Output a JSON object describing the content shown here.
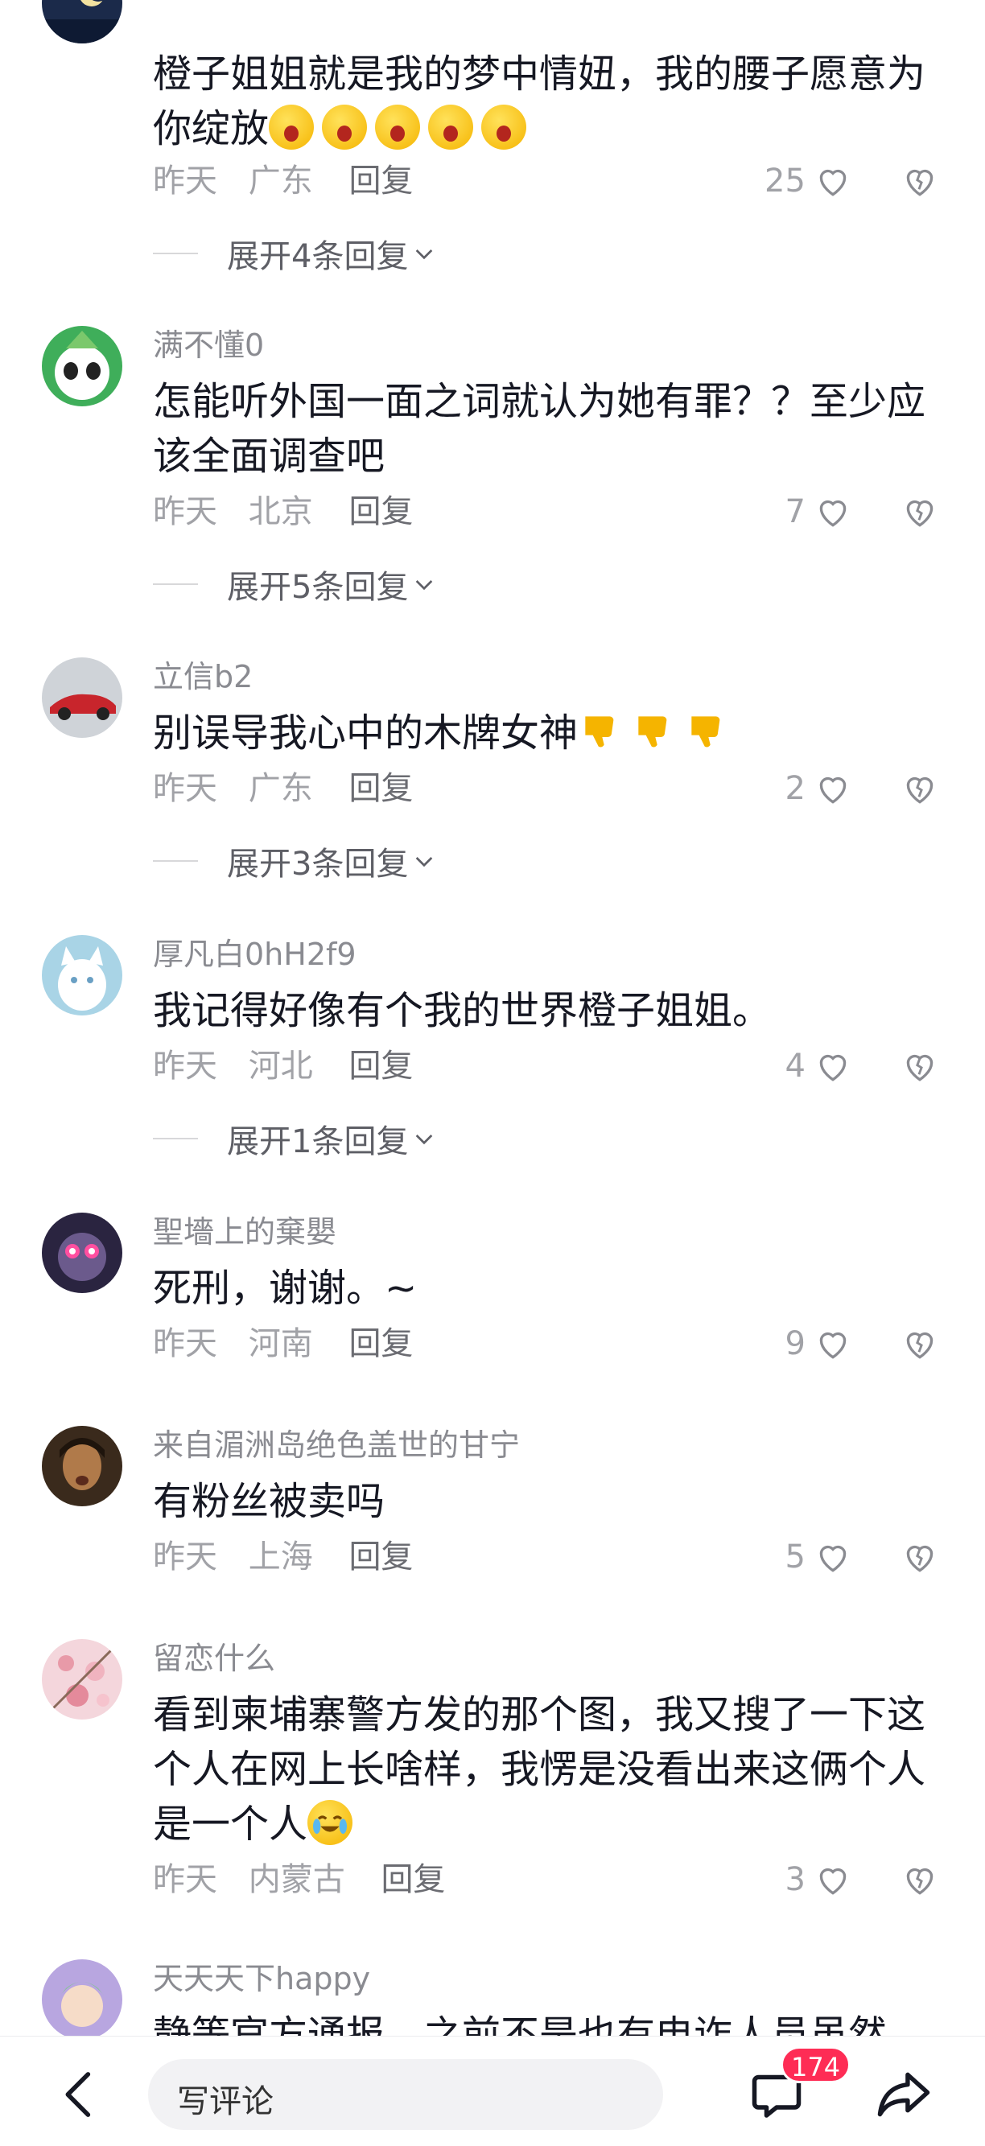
{
  "comments": [
    {
      "username": "",
      "text": "橙子姐姐就是我的梦中情妞，我的腰子愿意为你绽放",
      "emojis": [
        "shock-emoji",
        "shock-emoji",
        "shock-emoji",
        "shock-emoji",
        "shock-emoji"
      ],
      "time": "昨天",
      "location": "广东",
      "reply": "回复",
      "likes": "25",
      "expand": "展开4条回复"
    },
    {
      "username": "满不懂0",
      "text": "怎能听外国一面之词就认为她有罪？？至少应该全面调查吧",
      "emojis": [],
      "time": "昨天",
      "location": "北京",
      "reply": "回复",
      "likes": "7",
      "expand": "展开5条回复"
    },
    {
      "username": "立信b2",
      "text": "别误导我心中的木牌女神",
      "emojis": [
        "thumbs-down-emoji",
        "thumbs-down-emoji",
        "thumbs-down-emoji"
      ],
      "time": "昨天",
      "location": "广东",
      "reply": "回复",
      "likes": "2",
      "expand": "展开3条回复"
    },
    {
      "username": "厚凡白0hH2f9",
      "text": "我记得好像有个我的世界橙子姐姐。",
      "emojis": [],
      "time": "昨天",
      "location": "河北",
      "reply": "回复",
      "likes": "4",
      "expand": "展开1条回复"
    },
    {
      "username": "聖墻上的棄嬰",
      "text": "死刑，谢谢。~",
      "emojis": [],
      "time": "昨天",
      "location": "河南",
      "reply": "回复",
      "likes": "9",
      "expand": ""
    },
    {
      "username": "来自湄洲岛绝色盖世的甘宁",
      "text": "有粉丝被卖吗",
      "emojis": [],
      "time": "昨天",
      "location": "上海",
      "reply": "回复",
      "likes": "5",
      "expand": ""
    },
    {
      "username": "留恋什么",
      "text": "看到柬埔寨警方发的那个图，我又搜了一下这个人在网上长啥样，我愣是没看出来这俩个人是一个人",
      "emojis": [
        "crying-laughing-emoji"
      ],
      "time": "昨天",
      "location": "内蒙古",
      "reply": "回复",
      "likes": "3",
      "expand": ""
    },
    {
      "username": "天天天下happy",
      "text": "静等官方通报，之前不是也有电诈人员虽然",
      "emojis": [],
      "time": "",
      "location": "",
      "reply": "",
      "likes": "",
      "expand": ""
    }
  ],
  "bottom_bar": {
    "input_placeholder": "写评论",
    "comment_count": "174",
    "icons": [
      "back-arrow-icon",
      "comment-bubble-icon",
      "share-icon"
    ]
  },
  "colors": {
    "accent": "#fe2c55",
    "text": "#161823",
    "meta": "#a1a2a7"
  }
}
